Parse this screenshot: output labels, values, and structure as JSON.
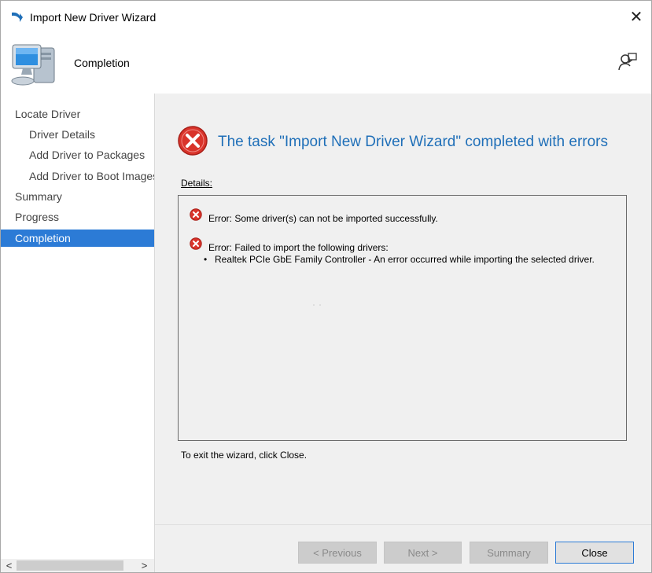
{
  "window": {
    "title": "Import New Driver Wizard",
    "close_glyph": "✕"
  },
  "header": {
    "title": "Completion"
  },
  "nav": {
    "items": [
      {
        "label": "Locate Driver",
        "level": "top"
      },
      {
        "label": "Driver Details",
        "level": "sub"
      },
      {
        "label": "Add Driver to Packages",
        "level": "sub"
      },
      {
        "label": "Add Driver to Boot Images",
        "level": "sub"
      },
      {
        "label": "Summary",
        "level": "top"
      },
      {
        "label": "Progress",
        "level": "top"
      },
      {
        "label": "Completion",
        "level": "top",
        "selected": true
      }
    ],
    "scroll_left": "<",
    "scroll_right": ">"
  },
  "main": {
    "headline": "The task \"Import New Driver Wizard\" completed with errors",
    "details_label": "Details:",
    "errors": [
      {
        "text": "Error: Some driver(s) can not be imported successfully."
      },
      {
        "text": "Error: Failed to import the following drivers:",
        "bullets": [
          "Realtek PCIe GbE Family Controller - An error occurred while importing the selected driver."
        ]
      }
    ],
    "exit_hint": "To exit the wizard, click Close."
  },
  "buttons": {
    "previous": "< Previous",
    "next": "Next >",
    "summary": "Summary",
    "close": "Close"
  },
  "colors": {
    "accent": "#2c7bd6",
    "headline": "#1f6fb8",
    "error": "#d9342b"
  }
}
